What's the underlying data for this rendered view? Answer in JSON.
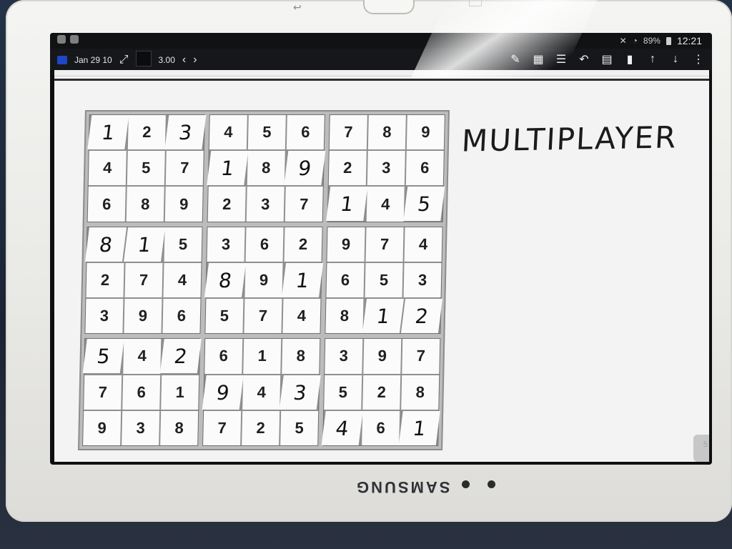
{
  "statusbar": {
    "battery": "89%",
    "time": "12:21"
  },
  "toolbar": {
    "date_label": "Jan 29 10",
    "pen_size": "3.00",
    "prev": "‹",
    "next": "›",
    "expand": "⤢",
    "icons": [
      "pen-settings-icon",
      "grid-icon",
      "page-layout-icon",
      "undo-icon",
      "clipboard-icon",
      "bookmark-icon",
      "arrow-up-icon",
      "arrow-down-icon",
      "more-icon"
    ]
  },
  "page": {
    "title": "MULTIPLAYER",
    "page_number": "5"
  },
  "sudoku": {
    "boxes": [
      [
        {
          "v": "1",
          "h": true
        },
        {
          "v": "2",
          "h": false
        },
        {
          "v": "3",
          "h": true
        },
        {
          "v": "4",
          "h": false
        },
        {
          "v": "5",
          "h": false
        },
        {
          "v": "7",
          "h": false
        },
        {
          "v": "6",
          "h": false
        },
        {
          "v": "8",
          "h": false
        },
        {
          "v": "9",
          "h": false
        }
      ],
      [
        {
          "v": "4",
          "h": false
        },
        {
          "v": "5",
          "h": false
        },
        {
          "v": "6",
          "h": false
        },
        {
          "v": "1",
          "h": true
        },
        {
          "v": "8",
          "h": false
        },
        {
          "v": "9",
          "h": true
        },
        {
          "v": "2",
          "h": false
        },
        {
          "v": "3",
          "h": false
        },
        {
          "v": "7",
          "h": false
        }
      ],
      [
        {
          "v": "7",
          "h": false
        },
        {
          "v": "8",
          "h": false
        },
        {
          "v": "9",
          "h": false
        },
        {
          "v": "2",
          "h": false
        },
        {
          "v": "3",
          "h": false
        },
        {
          "v": "6",
          "h": false
        },
        {
          "v": "1",
          "h": true
        },
        {
          "v": "4",
          "h": false
        },
        {
          "v": "5",
          "h": true
        }
      ],
      [
        {
          "v": "8",
          "h": true
        },
        {
          "v": "1",
          "h": true
        },
        {
          "v": "5",
          "h": false
        },
        {
          "v": "2",
          "h": false
        },
        {
          "v": "7",
          "h": false
        },
        {
          "v": "4",
          "h": false
        },
        {
          "v": "3",
          "h": false
        },
        {
          "v": "9",
          "h": false
        },
        {
          "v": "6",
          "h": false
        }
      ],
      [
        {
          "v": "3",
          "h": false
        },
        {
          "v": "6",
          "h": false
        },
        {
          "v": "2",
          "h": false
        },
        {
          "v": "8",
          "h": true
        },
        {
          "v": "9",
          "h": false
        },
        {
          "v": "1",
          "h": true
        },
        {
          "v": "5",
          "h": false
        },
        {
          "v": "7",
          "h": false
        },
        {
          "v": "4",
          "h": false
        }
      ],
      [
        {
          "v": "9",
          "h": false
        },
        {
          "v": "7",
          "h": false
        },
        {
          "v": "4",
          "h": false
        },
        {
          "v": "6",
          "h": false
        },
        {
          "v": "5",
          "h": false
        },
        {
          "v": "3",
          "h": false
        },
        {
          "v": "8",
          "h": false
        },
        {
          "v": "1",
          "h": true
        },
        {
          "v": "2",
          "h": true
        }
      ],
      [
        {
          "v": "5",
          "h": true
        },
        {
          "v": "4",
          "h": false
        },
        {
          "v": "2",
          "h": true
        },
        {
          "v": "7",
          "h": false
        },
        {
          "v": "6",
          "h": false
        },
        {
          "v": "1",
          "h": false
        },
        {
          "v": "9",
          "h": false
        },
        {
          "v": "3",
          "h": false
        },
        {
          "v": "8",
          "h": false
        }
      ],
      [
        {
          "v": "6",
          "h": false
        },
        {
          "v": "1",
          "h": false
        },
        {
          "v": "8",
          "h": false
        },
        {
          "v": "9",
          "h": true
        },
        {
          "v": "4",
          "h": false
        },
        {
          "v": "3",
          "h": true
        },
        {
          "v": "7",
          "h": false
        },
        {
          "v": "2",
          "h": false
        },
        {
          "v": "5",
          "h": false
        }
      ],
      [
        {
          "v": "3",
          "h": false
        },
        {
          "v": "9",
          "h": false
        },
        {
          "v": "7",
          "h": false
        },
        {
          "v": "5",
          "h": false
        },
        {
          "v": "2",
          "h": false
        },
        {
          "v": "8",
          "h": false
        },
        {
          "v": "4",
          "h": true
        },
        {
          "v": "6",
          "h": false
        },
        {
          "v": "1",
          "h": true
        }
      ]
    ]
  },
  "device": {
    "brand": "SAMSUNG"
  }
}
